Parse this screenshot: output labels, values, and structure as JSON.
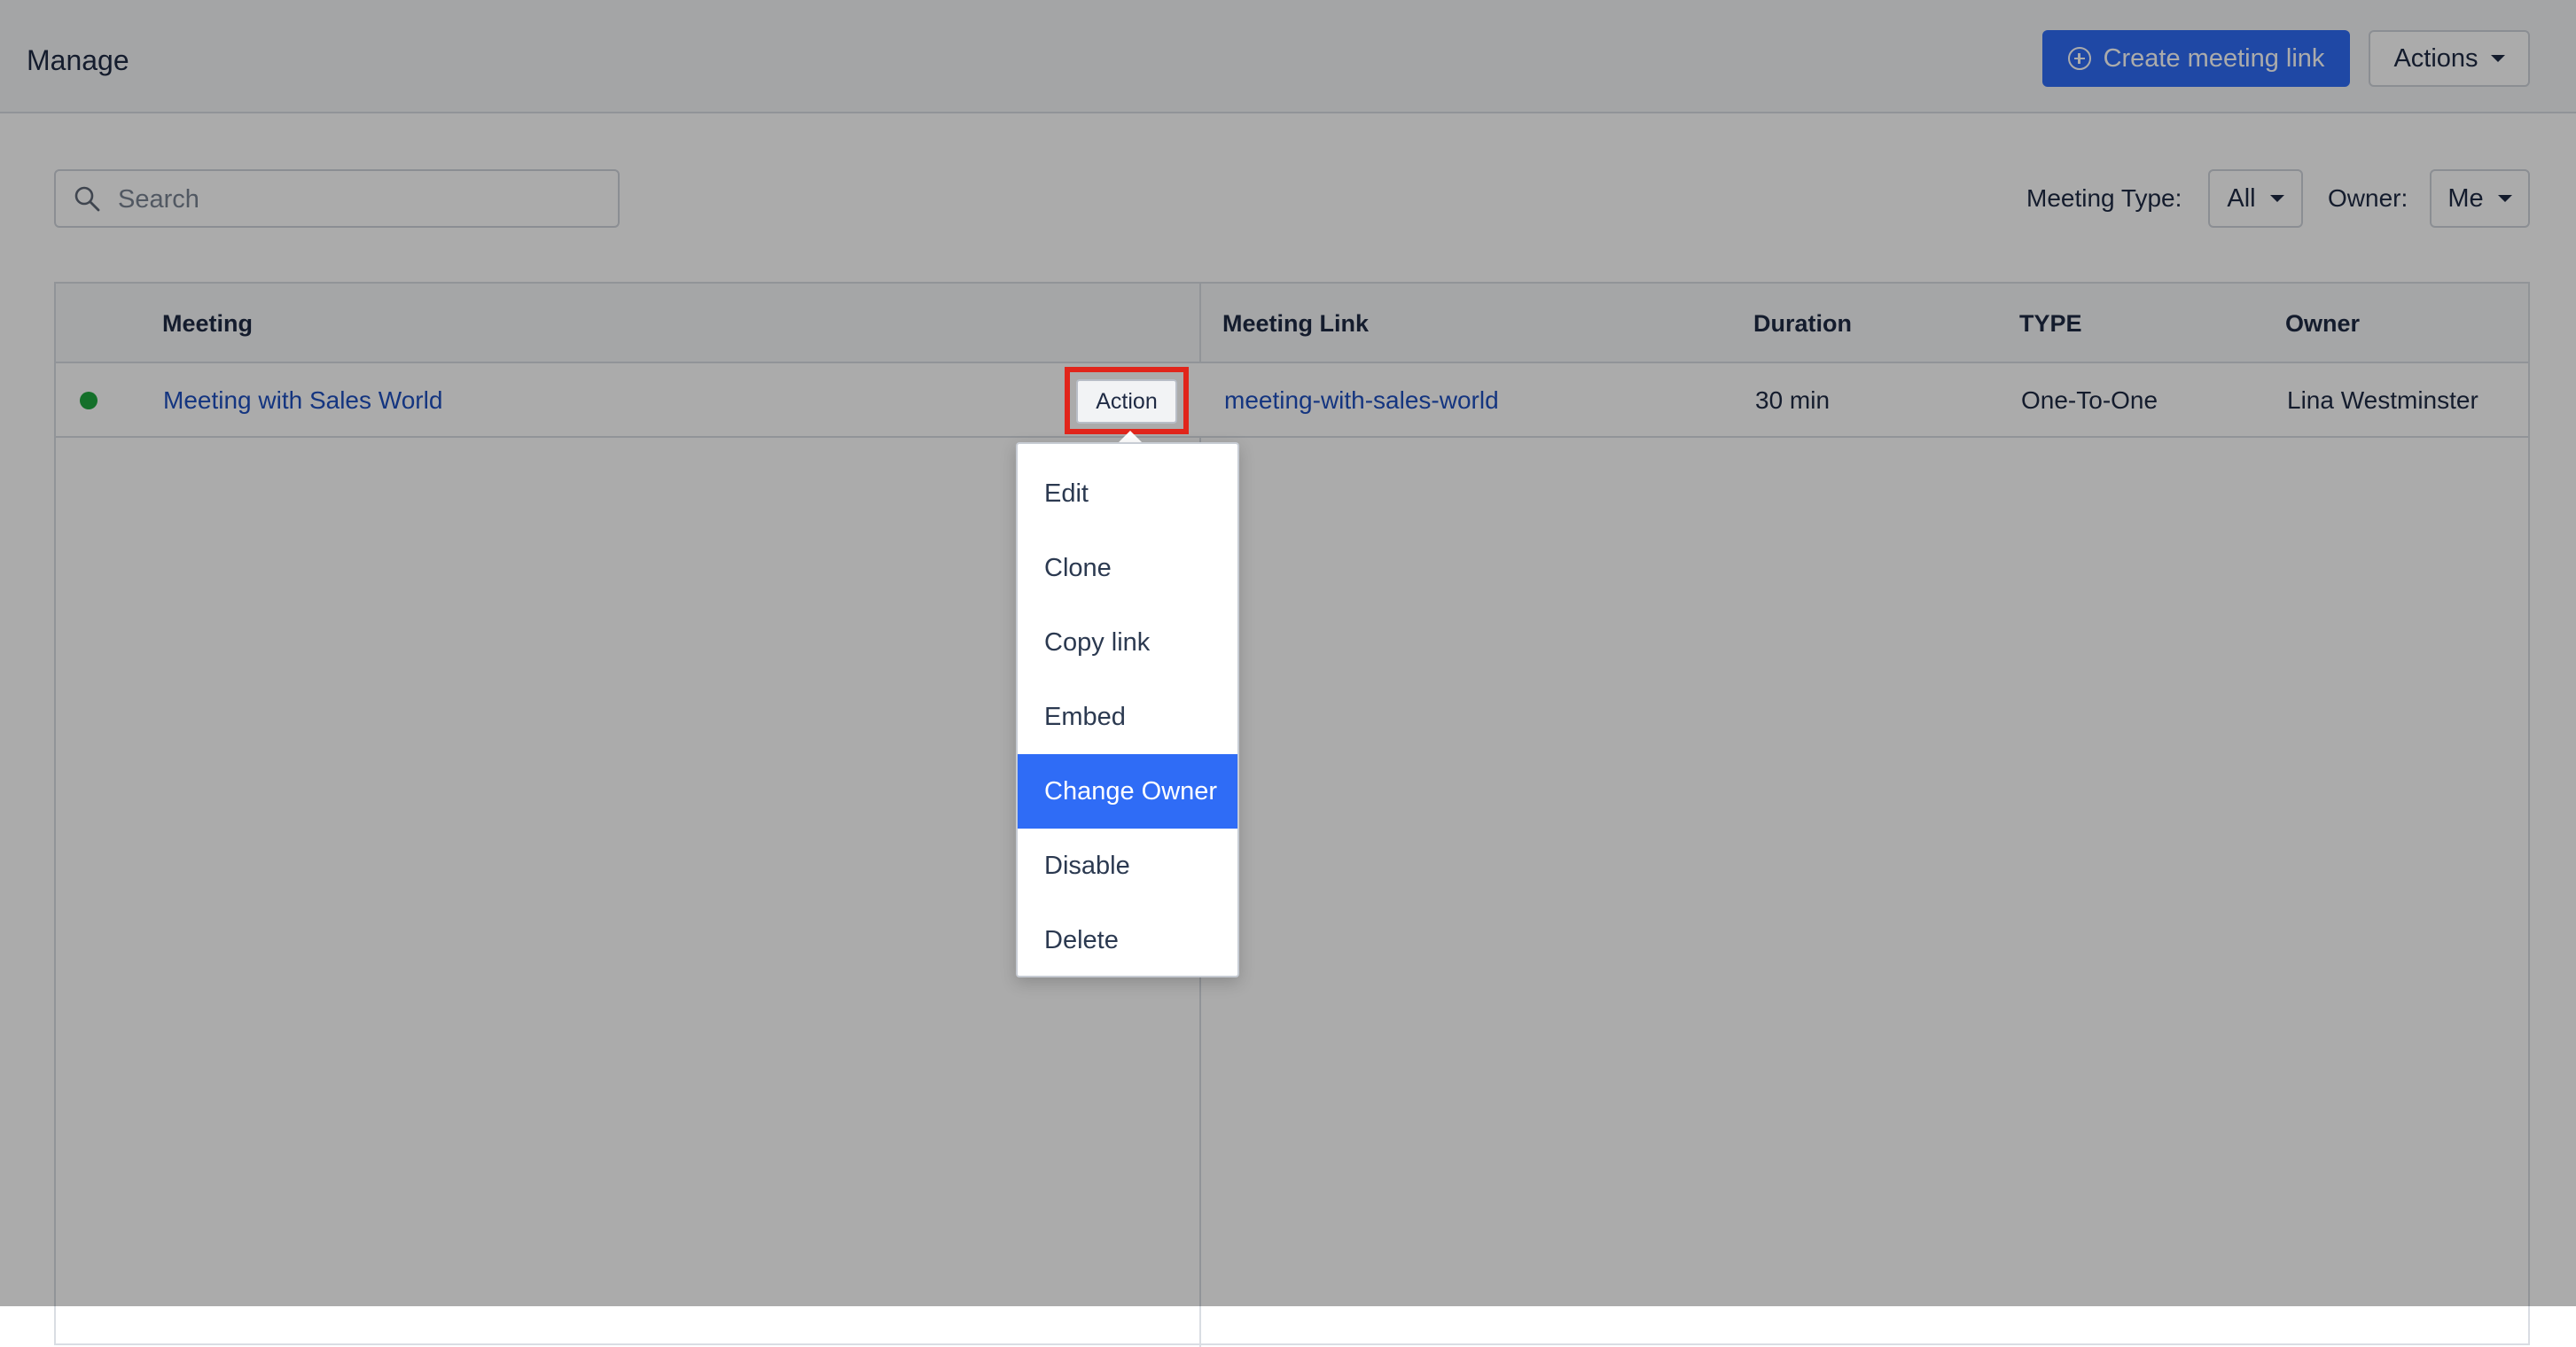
{
  "header": {
    "title": "Manage",
    "create_button": "Create meeting link",
    "actions_button": "Actions"
  },
  "search": {
    "placeholder": "Search",
    "value": ""
  },
  "filters": {
    "meeting_type_label": "Meeting Type:",
    "meeting_type_value": "All",
    "owner_label": "Owner:",
    "owner_value": "Me"
  },
  "table": {
    "columns": [
      "Meeting",
      "Meeting Link",
      "Duration",
      "TYPE",
      "Owner"
    ],
    "rows": [
      {
        "status": "active",
        "meeting": "Meeting with Sales World",
        "action_label": "Action",
        "meeting_link": "meeting-with-sales-world",
        "duration": "30 min",
        "type": "One-To-One",
        "owner": "Lina Westminster"
      }
    ]
  },
  "action_menu": {
    "items": [
      "Edit",
      "Clone",
      "Copy link",
      "Embed",
      "Change Owner",
      "Disable",
      "Delete"
    ],
    "highlighted": "Change Owner"
  },
  "colors": {
    "primary": "#2f6cf6",
    "status_active": "#1fa83f",
    "highlight_frame": "#e1251b",
    "link": "#1f4fbf"
  }
}
